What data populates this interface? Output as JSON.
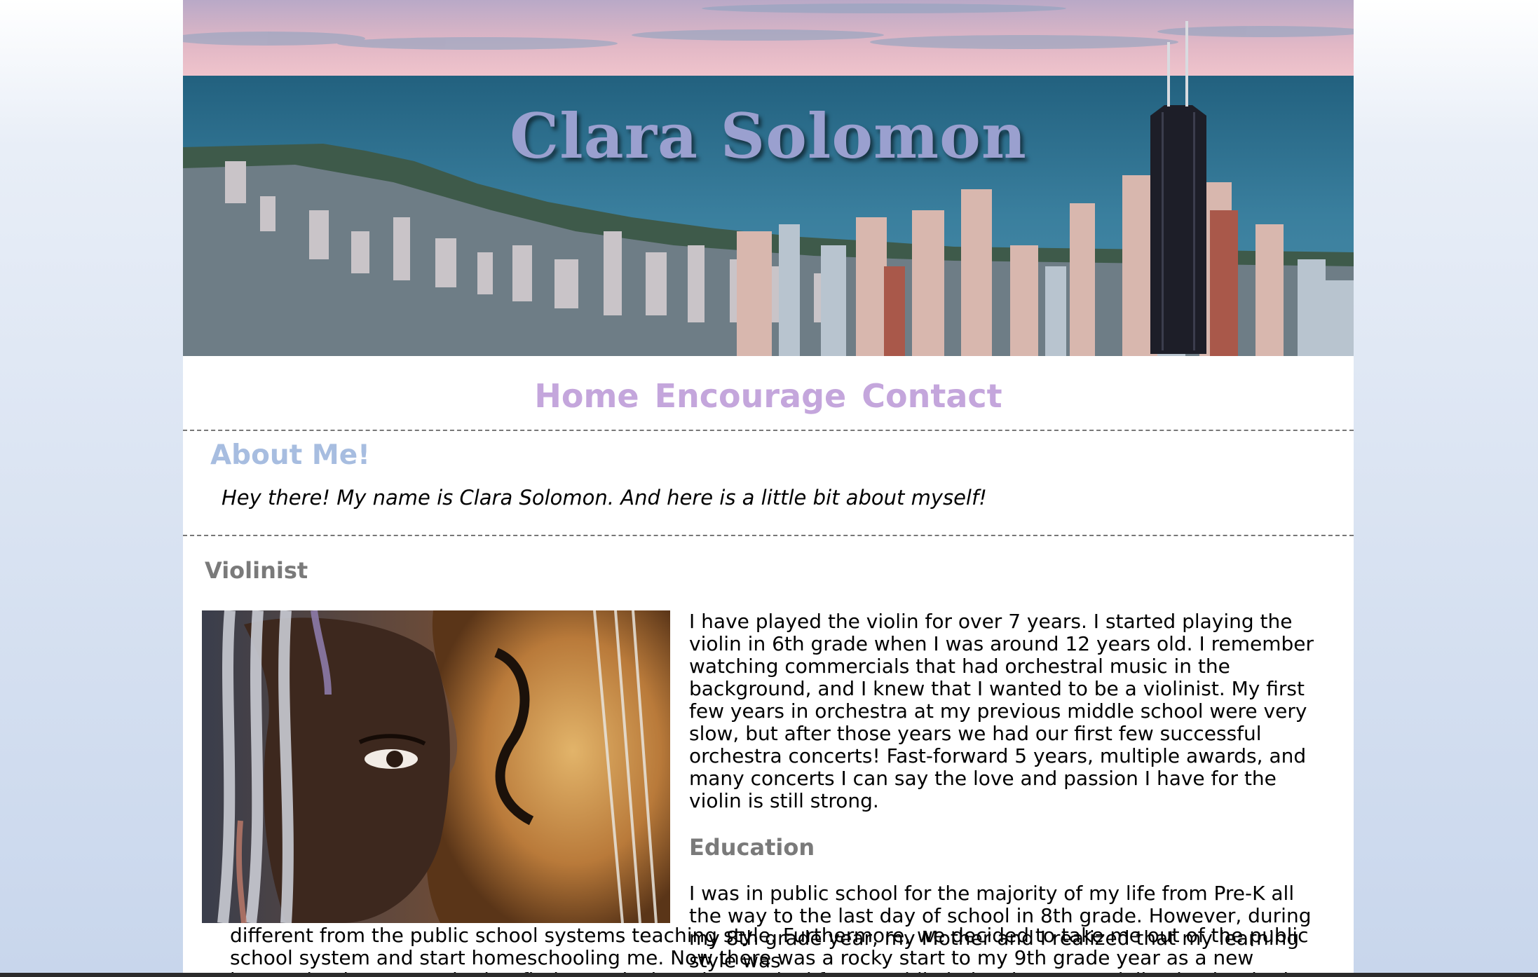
{
  "header": {
    "title": "Clara Solomon"
  },
  "nav": {
    "items": [
      "Home",
      "Encourage",
      "Contact"
    ]
  },
  "about": {
    "heading": "About Me!",
    "intro": "Hey there! My name is Clara Solomon. And here is a little bit about myself!"
  },
  "violinist": {
    "heading": "Violinist",
    "text": "I have played the violin for over 7 years. I started playing the violin in 6th grade when I was around 12 years old. I remember watching commercials that had orchestral music in the background, and I knew that I wanted to be a violinist. My first few years in orchestra at my previous middle school were very slow, but after those years we had our first few successful orchestra concerts! Fast-forward 5 years, multiple awards, and many concerts I can say the love and passion I have for the violin is still strong."
  },
  "education": {
    "heading": "Education",
    "text_top": "I was in public school for the majority of my life from Pre-K all the way to the last day of school in 8th grade. However, during my 8th grade year, my Mother and I realized that my learning style was",
    "text_bottom": "different from the public school systems teaching style. Furthermore, we decided to take me out of the public school system and start homeschooling me. Now there was a rocky start to my 9th grade year as a new homeschool. My mom had to find a curriculum that worked for me while balancing my socialization but in the end everything worked out. I had"
  }
}
